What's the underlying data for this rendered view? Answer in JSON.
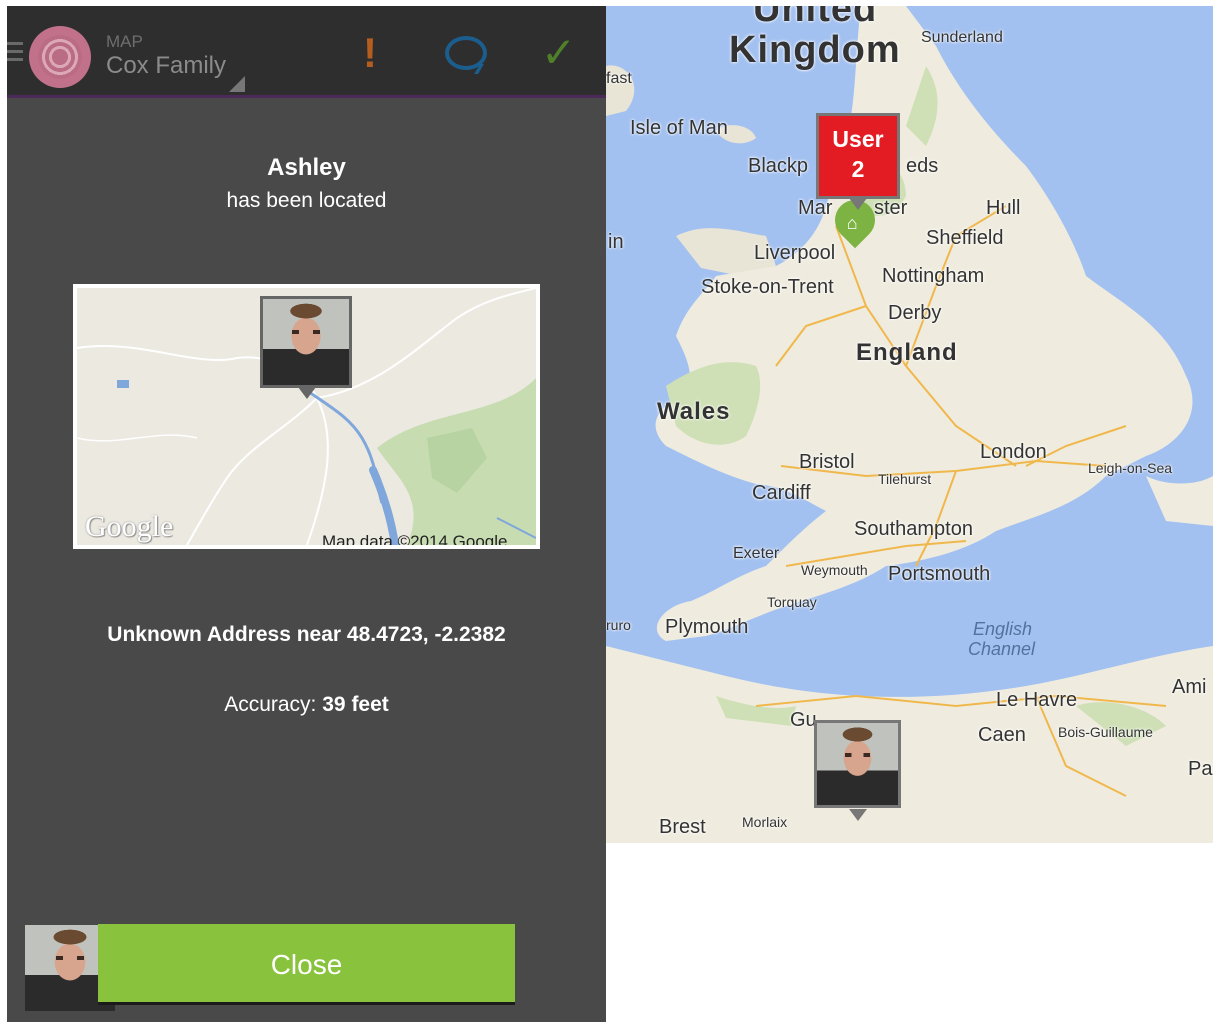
{
  "app_bar": {
    "kicker": "MAP",
    "title": "Cox Family",
    "icons": [
      "menu-icon",
      "app-logo",
      "alert-icon",
      "chat-icon",
      "check-icon"
    ],
    "colors": {
      "alert": "#b35d1f",
      "chat": "#1b5e8e",
      "check": "#4f7f28"
    }
  },
  "dialog": {
    "name": "Ashley",
    "subtitle": "has been located",
    "mini_map": {
      "brand": "Google",
      "credit": "Map data ©2014 Google"
    },
    "address": "Unknown Address near 48.4723, -2.2382",
    "accuracy_label": "Accuracy:",
    "accuracy_value": "39 feet",
    "close_label": "Close",
    "close_color": "#89c23c"
  },
  "map": {
    "labels": {
      "united": "United",
      "kingdom": "Kingdom",
      "sunderland": "Sunderland",
      "belfast": "fast",
      "isle_of_man": "Isle of Man",
      "blackpool": "Blackp",
      "leeds": "eds",
      "manchester_a": "Mar",
      "manchester_b": "ster",
      "hull": "Hull",
      "dublin": "in",
      "sheffield": "Sheffield",
      "liverpool": "Liverpool",
      "nottingham": "Nottingham",
      "stoke": "Stoke-on-Trent",
      "derby": "Derby",
      "england": "England",
      "wales": "Wales",
      "london": "London",
      "bristol": "Bristol",
      "tilehurst": "Tilehurst",
      "southend": "Leigh-on-Sea",
      "cardiff": "Cardiff",
      "southampton": "Southampton",
      "exeter": "Exeter",
      "weymouth": "Weymouth",
      "portsmouth": "Portsmouth",
      "torquay": "Torquay",
      "truro": "ruro",
      "plymouth": "Plymouth",
      "english": "English",
      "channel": "Channel",
      "amiens": "Ami",
      "le_havre": "Le Havre",
      "guernsey": "Gu",
      "caen": "Caen",
      "bois_guillaume": "Bois-Guillaume",
      "paris": "Pa",
      "brest": "Brest",
      "morlaix": "Morlaix"
    },
    "user_marker": {
      "line1": "User",
      "line2": "2",
      "color": "#e31c24"
    },
    "home_marker": {
      "icon": "home-icon",
      "color": "#7cb342"
    }
  }
}
